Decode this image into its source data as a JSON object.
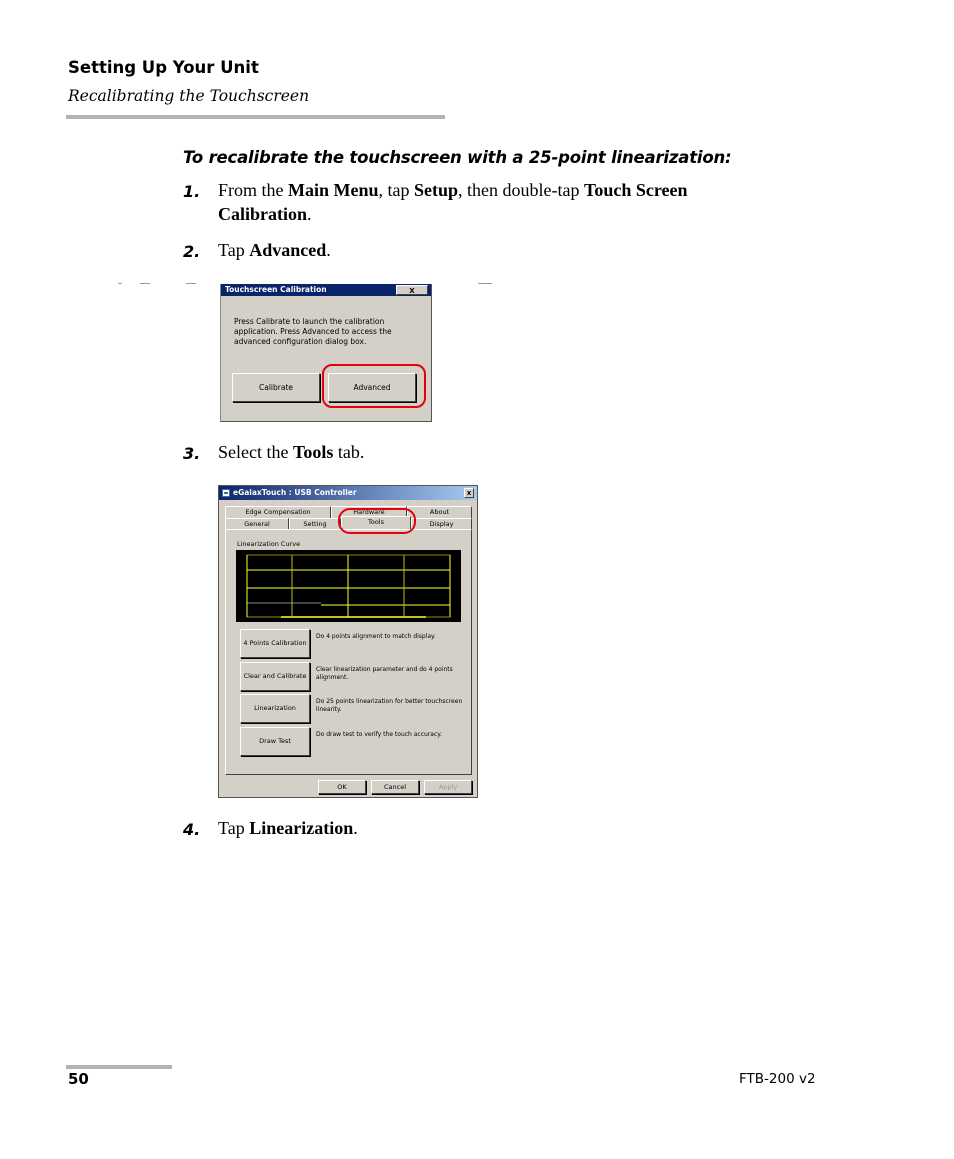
{
  "header": {
    "section": "Setting Up Your Unit",
    "subsection": "Recalibrating the Touchscreen"
  },
  "procedure": {
    "title": "To recalibrate the touchscreen with a 25-point linearization:",
    "steps": [
      {
        "num": "1.",
        "parts": [
          "From the ",
          "Main Menu",
          ", tap ",
          "Setup",
          ", then double-tap ",
          "Touch Screen Calibration",
          "."
        ]
      },
      {
        "num": "2.",
        "parts": [
          "Tap ",
          "Advanced",
          "."
        ]
      },
      {
        "num": "3.",
        "parts": [
          "Select the ",
          "Tools",
          " tab."
        ]
      },
      {
        "num": "4.",
        "parts": [
          "Tap ",
          "Linearization",
          "."
        ]
      }
    ]
  },
  "dialog_calibration": {
    "title": "Touchscreen Calibration",
    "close": "X",
    "message": "Press Calibrate to launch the calibration application. Press Advanced to access the advanced configuration dialog box.",
    "buttons": {
      "calibrate": "Calibrate",
      "advanced": "Advanced"
    },
    "highlight_color": "#e3000f"
  },
  "dialog_controller": {
    "title": "eGalaxTouch : USB Controller",
    "close": "x",
    "tabs_back": [
      "Edge Compensation",
      "Hardware",
      "About"
    ],
    "tabs_front": [
      "General",
      "Setting",
      "Tools",
      "Display"
    ],
    "active_tab": "Tools",
    "curve_label": "Linearization Curve",
    "curve_color": "#ffff33",
    "tools": [
      {
        "button": "4 Points Calibration",
        "desc": "Do 4 points alignment to match display."
      },
      {
        "button": "Clear and Calibrate",
        "desc": "Clear linearization parameter and do 4 points alignment."
      },
      {
        "button": "Linearization",
        "desc": "Do 25 points linearization for better touchscreen linearity."
      },
      {
        "button": "Draw Test",
        "desc": "Do draw test to verify the touch accuracy."
      }
    ],
    "footer_buttons": {
      "ok": "OK",
      "cancel": "Cancel",
      "apply": "Apply"
    }
  },
  "footer": {
    "page_number": "50",
    "doc_id": "FTB-200 v2"
  }
}
